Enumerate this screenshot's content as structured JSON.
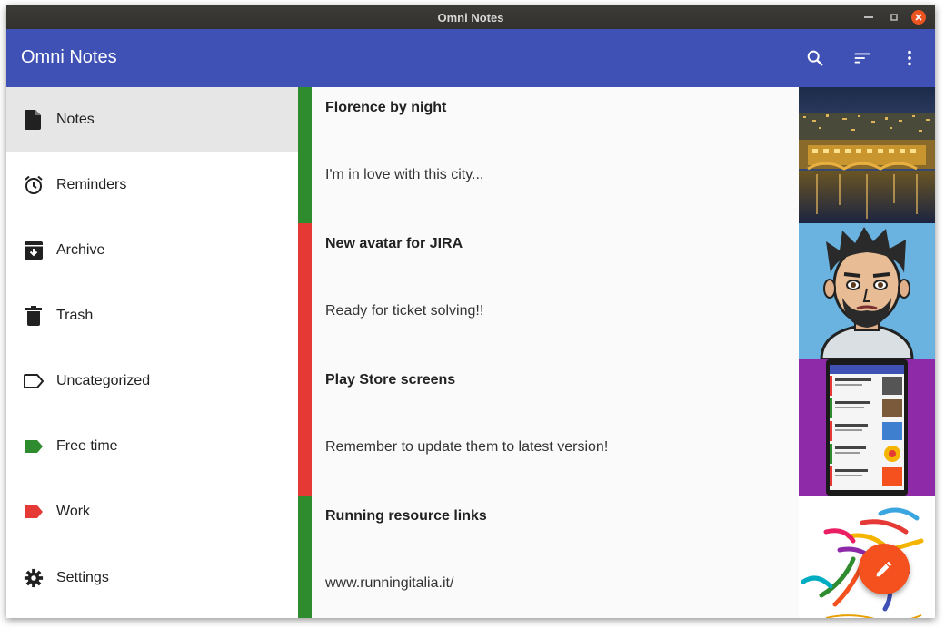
{
  "window": {
    "title": "Omni Notes",
    "minimize": "–",
    "maximize": "▫",
    "close": "×"
  },
  "appbar": {
    "title": "Omni Notes",
    "actions": [
      "search-icon",
      "sort-icon",
      "more-vert-icon"
    ]
  },
  "drawer": {
    "items": [
      {
        "label": "Notes",
        "icon": "note-icon",
        "active": true
      },
      {
        "label": "Reminders",
        "icon": "alarm-icon"
      },
      {
        "label": "Archive",
        "icon": "archive-icon"
      },
      {
        "label": "Trash",
        "icon": "trash-icon"
      },
      {
        "label": "Uncategorized",
        "icon": "label-outline-icon"
      },
      {
        "label": "Free time",
        "icon": "label-icon",
        "color": "#2e8b2e"
      },
      {
        "label": "Work",
        "icon": "label-icon",
        "color": "#e53935"
      }
    ],
    "settings": {
      "label": "Settings",
      "icon": "gear-icon"
    }
  },
  "notes": [
    {
      "title": "Florence by night",
      "body": "I'm in love with this city...",
      "category_color": "#2e8b2e",
      "thumbnail": "city-night-photo"
    },
    {
      "title": "New avatar for JIRA",
      "body": "Ready for ticket solving!!",
      "category_color": "#e53935",
      "thumbnail": "avatar-illustration"
    },
    {
      "title": "Play Store screens",
      "body": "Remember to update them to latest version!",
      "category_color": "#e53935",
      "thumbnail": "phone-screenshot"
    },
    {
      "title": "Running resource links",
      "body": "www.runningitalia.it/",
      "category_color": "#2e8b2e",
      "thumbnail": "runner-artwork"
    }
  ],
  "fab": {
    "icon": "pencil-icon"
  },
  "colors": {
    "primary": "#3f51b5",
    "accent": "#f4511e",
    "titlebar": "#393838"
  }
}
